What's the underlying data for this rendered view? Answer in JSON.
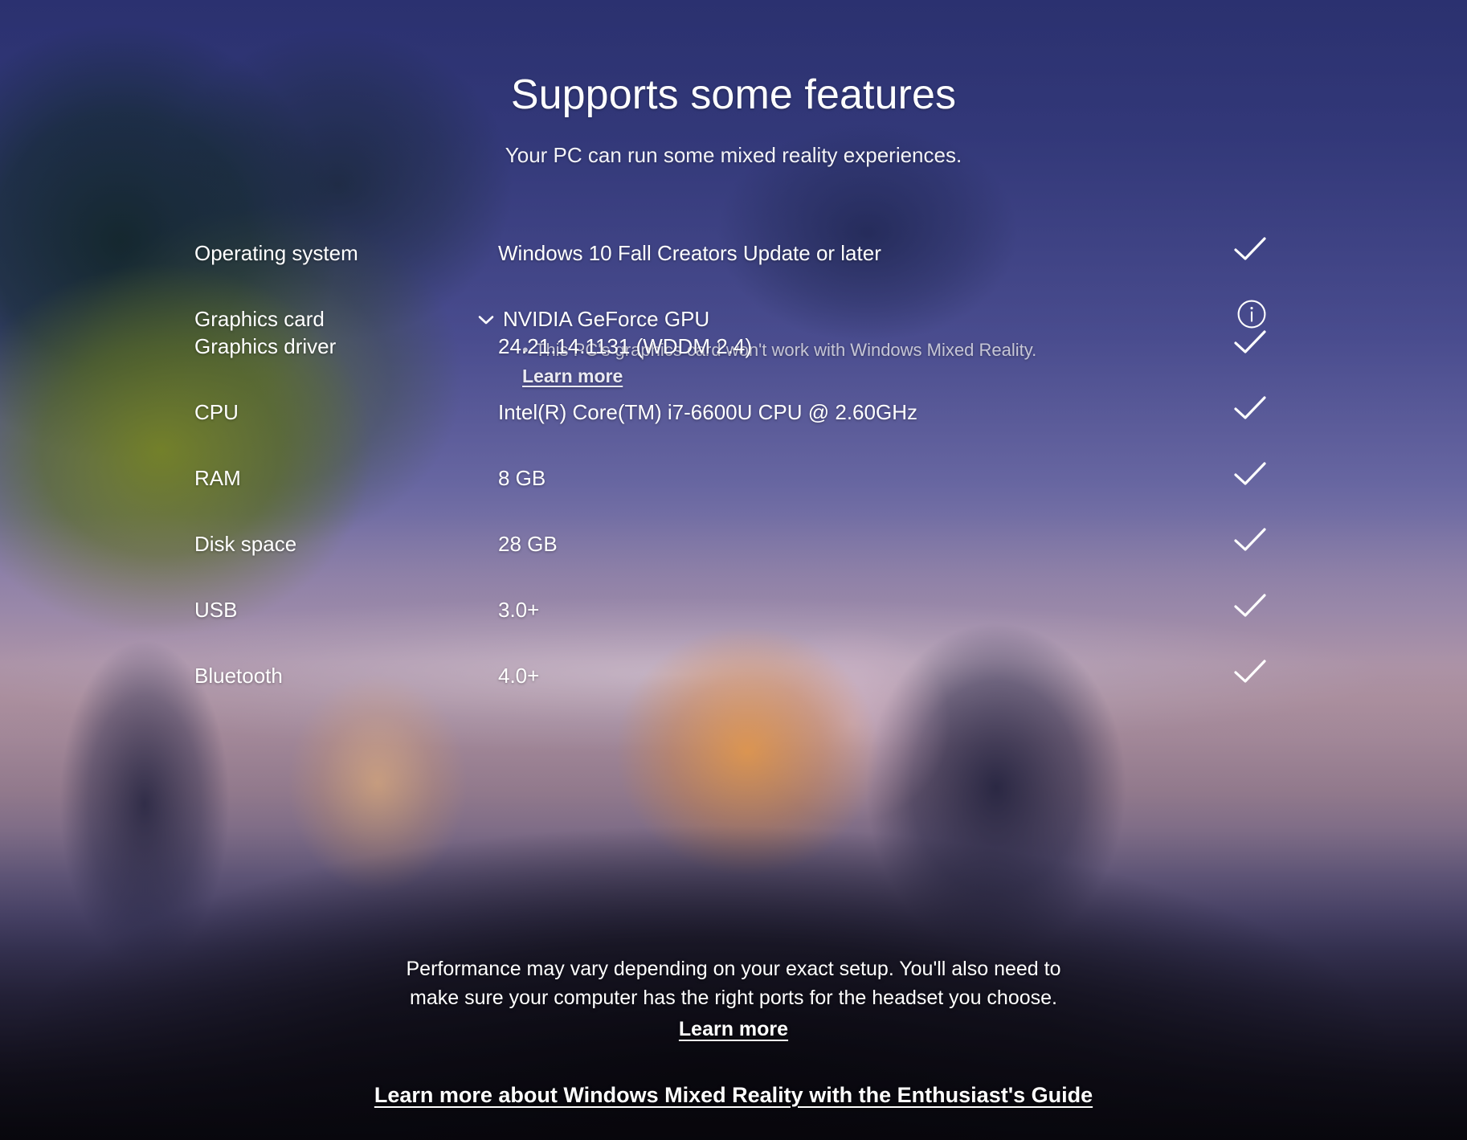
{
  "header": {
    "title": "Supports some features",
    "subtitle": "Your PC can run some mixed reality experiences."
  },
  "specs": {
    "rows": [
      {
        "label": "Operating system",
        "value": "Windows 10 Fall Creators Update or later",
        "status": "check",
        "status_icon": "checkmark-icon",
        "expandable": false
      },
      {
        "label": "Graphics card",
        "value": "NVIDIA GeForce GPU",
        "status": "info",
        "status_icon": "info-circle-icon",
        "expandable": true,
        "expand_icon": "chevron-down-icon",
        "detail_bullet": "This PC's graphics card won't work with Windows Mixed Reality.",
        "detail_link": "Learn more"
      },
      {
        "label": "Graphics driver",
        "value": "24.21.14.1131 (WDDM 2.4)",
        "status": "check",
        "status_icon": "checkmark-icon",
        "expandable": false
      },
      {
        "label": "CPU",
        "value": "Intel(R) Core(TM) i7-6600U CPU @ 2.60GHz",
        "status": "check",
        "status_icon": "checkmark-icon",
        "expandable": false
      },
      {
        "label": "RAM",
        "value": "8 GB",
        "status": "check",
        "status_icon": "checkmark-icon",
        "expandable": false
      },
      {
        "label": "Disk space",
        "value": "28 GB",
        "status": "check",
        "status_icon": "checkmark-icon",
        "expandable": false
      },
      {
        "label": "USB",
        "value": "3.0+",
        "status": "check",
        "status_icon": "checkmark-icon",
        "expandable": false
      },
      {
        "label": "Bluetooth",
        "value": "4.0+",
        "status": "check",
        "status_icon": "checkmark-icon",
        "expandable": false
      }
    ]
  },
  "footer": {
    "note_line_1": "Performance may vary depending on your exact setup. You'll also need to",
    "note_line_2": "make sure your computer has the right ports for the headset you choose.",
    "learn_more": "Learn more",
    "guide_link": "Learn more about Windows Mixed Reality with the Enthusiast's Guide"
  },
  "colors": {
    "text_primary": "#ffffff",
    "text_secondary": "#c6c6d6",
    "sky_top": "#2c3271",
    "sky_mid": "#8d83ae",
    "ground_bottom": "#0a0910",
    "warm_glow": "#ffa84a"
  }
}
